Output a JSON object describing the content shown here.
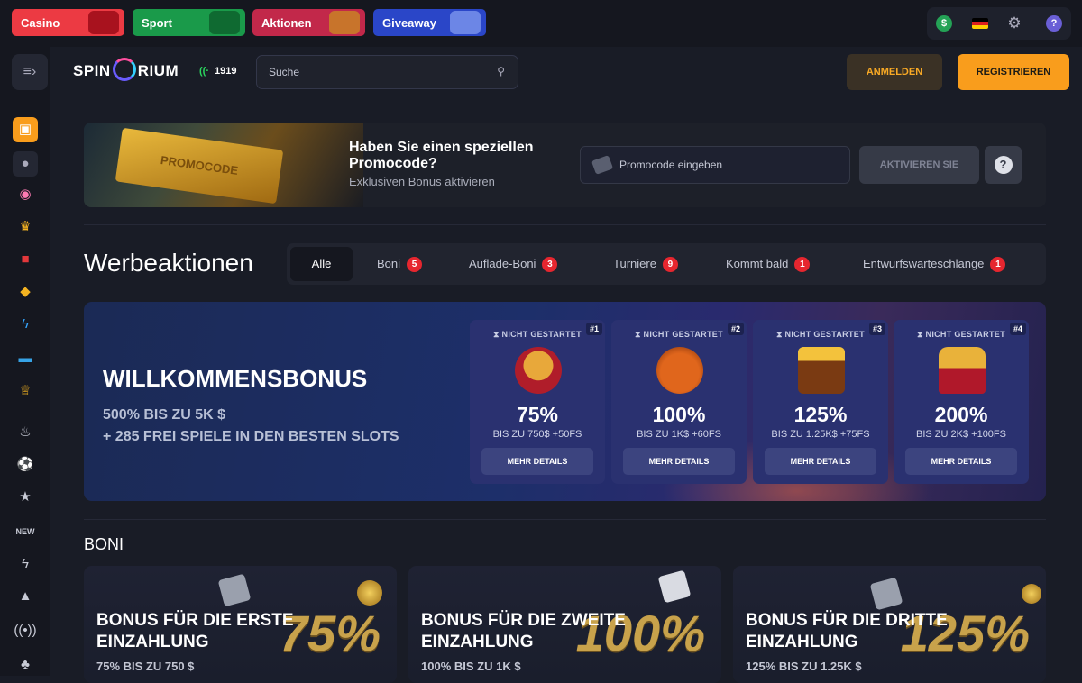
{
  "categories": [
    {
      "label": "Casino",
      "color": "#ec3a43",
      "icon": "slot-machine-icon"
    },
    {
      "label": "Sport",
      "color": "#1a9a4a",
      "icon": "gamepad-ball-icon"
    },
    {
      "label": "Aktionen",
      "color": "#c2284a",
      "icon": "gift-icon"
    },
    {
      "label": "Giveaway",
      "color": "#2a46c8",
      "icon": "phone-watch-icon"
    }
  ],
  "header": {
    "logo_left": "SPIN",
    "logo_right": "RIUM",
    "online_count": "1919",
    "search_placeholder": "Suche",
    "login_label": "ANMELDEN",
    "register_label": "REGISTRIEREN"
  },
  "promo": {
    "ticket_text": "PROMOCODE",
    "title": "Haben Sie einen speziellen Promocode?",
    "subtitle": "Exklusiven Bonus aktivieren",
    "input_placeholder": "Promocode eingeben",
    "activate_label": "AKTIVIEREN SIE",
    "help_label": "?"
  },
  "promotions": {
    "heading": "Werbeaktionen",
    "tabs": [
      {
        "label": "Alle",
        "count": ""
      },
      {
        "label": "Boni",
        "count": "5"
      },
      {
        "label": "Auflade-Boni",
        "count": "3"
      },
      {
        "label": "Turniere",
        "count": "9"
      },
      {
        "label": "Kommt bald",
        "count": "1"
      },
      {
        "label": "Entwurfswarteschlange",
        "count": "1"
      }
    ]
  },
  "welcome": {
    "title": "WILLKOMMENSBONUS",
    "line1": "500% BIS ZU 5K $",
    "line2": "+ 285 FREI SPIELE IN DEN BESTEN SLOTS",
    "cards": [
      {
        "num": "#1",
        "status": "NICHT GESTARTET",
        "pct": "75%",
        "detail": "BIS ZU 750$ +50FS",
        "button": "MEHR DETAILS",
        "prize": "coin-pillow-icon"
      },
      {
        "num": "#2",
        "status": "NICHT GESTARTET",
        "pct": "100%",
        "detail": "BIS ZU 1K$ +60FS",
        "button": "MEHR DETAILS",
        "prize": "money-bag-icon"
      },
      {
        "num": "#3",
        "status": "NICHT GESTARTET",
        "pct": "125%",
        "detail": "BIS ZU 1.25K$ +75FS",
        "button": "MEHR DETAILS",
        "prize": "treasure-chest-icon"
      },
      {
        "num": "#4",
        "status": "NICHT GESTARTET",
        "pct": "200%",
        "detail": "BIS ZU 2K$ +100FS",
        "button": "MEHR DETAILS",
        "prize": "crown-icon"
      }
    ]
  },
  "boni": {
    "heading": "BONI",
    "cards": [
      {
        "title": "BONUS FÜR DIE ERSTE EINZAHLUNG",
        "big": "75%",
        "sub": "75% BIS ZU 750 $"
      },
      {
        "title": "BONUS FÜR DIE ZWEITE EINZAHLUNG",
        "big": "100%",
        "sub": "100% BIS ZU 1K $"
      },
      {
        "title": "BONUS FÜR DIE DRITTE EINZAHLUNG",
        "big": "125%",
        "sub": "125% BIS ZU 1.25K $"
      }
    ]
  },
  "sidebar": {
    "icons": [
      "sport-icon",
      "basketball-icon",
      "wheel-icon",
      "trophy-icon",
      "gift-icon",
      "gem-icon",
      "lightning-icon",
      "ticket-icon",
      "crown-icon",
      "fire-icon",
      "football-icon",
      "star-icon",
      "new-icon",
      "bolt-icon",
      "logo-icon",
      "live-icon",
      "cherry-icon"
    ]
  }
}
